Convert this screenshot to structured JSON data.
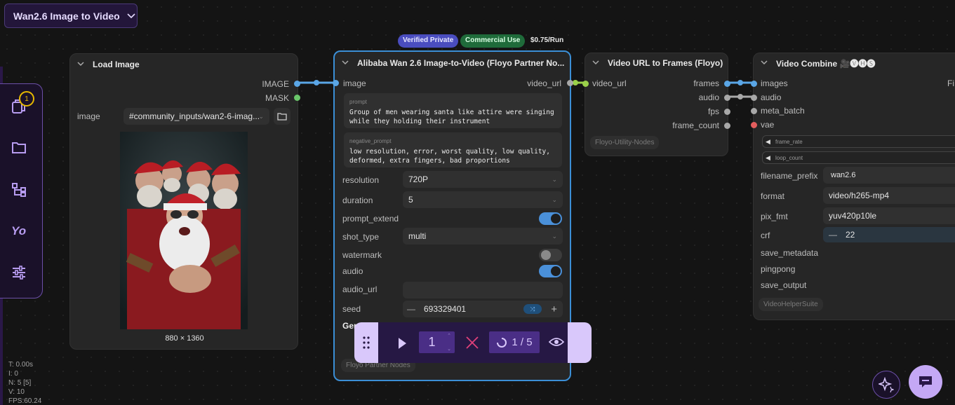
{
  "workflow": {
    "title": "Wan2.6 Image to Video"
  },
  "sidebar": {
    "queue_badge": "1",
    "icons": [
      "queue-icon",
      "folder-icon",
      "nodes-tree-icon",
      "models-icon",
      "settings-sliders-icon"
    ]
  },
  "load_image": {
    "title": "Load Image",
    "outputs": [
      "IMAGE",
      "MASK"
    ],
    "image_label": "image",
    "image_value": "#community_inputs/wan2-6-imag...",
    "dimensions": "880 × 1360"
  },
  "badges": {
    "verified": "Verified Private",
    "commercial": "Commercial Use",
    "price": "$0.75/Run"
  },
  "wan_node": {
    "title": "Alibaba Wan 2.6 Image-to-Video (Floyo Partner No...",
    "input": "image",
    "output": "video_url",
    "prompt_label": "prompt",
    "prompt_line1": "Group of men wearing santa like attire were singing",
    "prompt_line2": "while they holding their instrument",
    "neg_label": "negative_prompt",
    "neg_line1": "low resolution, error, worst quality, low quality,",
    "neg_line2": "deformed, extra fingers, bad proportions",
    "resolution_label": "resolution",
    "resolution_value": "720P",
    "duration_label": "duration",
    "duration_value": "5",
    "prompt_extend_label": "prompt_extend",
    "shot_type_label": "shot_type",
    "shot_type_value": "multi",
    "watermark_label": "watermark",
    "audio_label": "audio",
    "audio_url_label": "audio_url",
    "seed_label": "seed",
    "seed_value": "693329401",
    "gen_label": "Gen",
    "footer_tag": "Floyo Partner Nodes"
  },
  "frames_node": {
    "title": "Video URL to Frames (Floyo)",
    "input": "video_url",
    "outputs": [
      "frames",
      "audio",
      "fps",
      "frame_count"
    ],
    "tag": "Floyo-Utility-Nodes"
  },
  "combine_node": {
    "title": "Video Combine 🎥🅥🅗🅢",
    "inputs": [
      "images",
      "audio",
      "meta_batch",
      "vae"
    ],
    "output_partial": "Fi",
    "frame_rate": "frame_rate",
    "loop_count": "loop_count",
    "filename_prefix_label": "filename_prefix",
    "filename_prefix_value": "wan2.6",
    "format_label": "format",
    "format_value": "video/h265-mp4",
    "pix_fmt_label": "pix_fmt",
    "pix_fmt_value": "yuv420p10le",
    "crf_label": "crf",
    "crf_value": "22",
    "save_metadata": "save_metadata",
    "pingpong": "pingpong",
    "save_output": "save_output",
    "tag": "VideoHelperSuite"
  },
  "toolbar": {
    "batch_count": "1",
    "queue_progress": "1 / 5"
  },
  "stats": {
    "t": "T: 0.00s",
    "i": "I: 0",
    "n": "N: 5 [5]",
    "v": "V: 10",
    "fps": "FPS:60.24"
  },
  "colors": {
    "accent": "#4a90d9",
    "purple": "#d9c8fb",
    "link_blue": "#5aa6e6"
  }
}
